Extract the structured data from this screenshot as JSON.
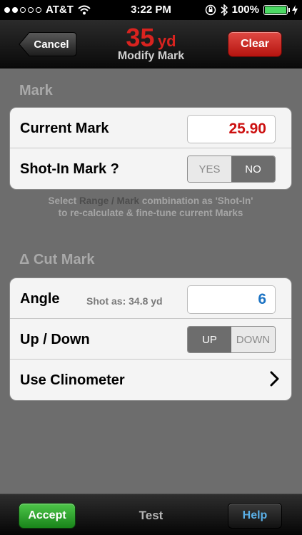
{
  "status_bar": {
    "carrier": "AT&T",
    "time": "3:22 PM",
    "battery": "100%",
    "signal_bars_filled": 2,
    "signal_bars_total": 5
  },
  "nav": {
    "back_label": "Cancel",
    "distance_value": "35",
    "distance_unit": "yd",
    "subtitle": "Modify Mark",
    "clear_label": "Clear"
  },
  "mark_section": {
    "header": "Mark",
    "current_mark_label": "Current Mark",
    "current_mark_value": "25.90",
    "shot_in_label": "Shot-In Mark ?",
    "shot_in_yes": "YES",
    "shot_in_no": "NO",
    "shot_in_selected": "NO",
    "note_line1_pre": "Select",
    "note_line1_hi": "Range / Mark",
    "note_line1_post": "combination as 'Shot-In'",
    "note_line2": "to re-calculate & fine-tune current Marks"
  },
  "cut_section": {
    "header": "Δ Cut Mark",
    "angle_label": "Angle",
    "angle_sub": "Shot as: 34.8 yd",
    "angle_value": "6",
    "updown_label": "Up / Down",
    "up_label": "UP",
    "down_label": "DOWN",
    "updown_selected": "UP",
    "clinometer_label": "Use Clinometer"
  },
  "toolbar": {
    "accept_label": "Accept",
    "title": "Test",
    "help_label": "Help"
  },
  "colors": {
    "accent_red": "#d9231f",
    "value_red": "#cc1010",
    "value_blue": "#1d74c4",
    "accept_green": "#19841a",
    "help_blue": "#5ab0e8"
  }
}
